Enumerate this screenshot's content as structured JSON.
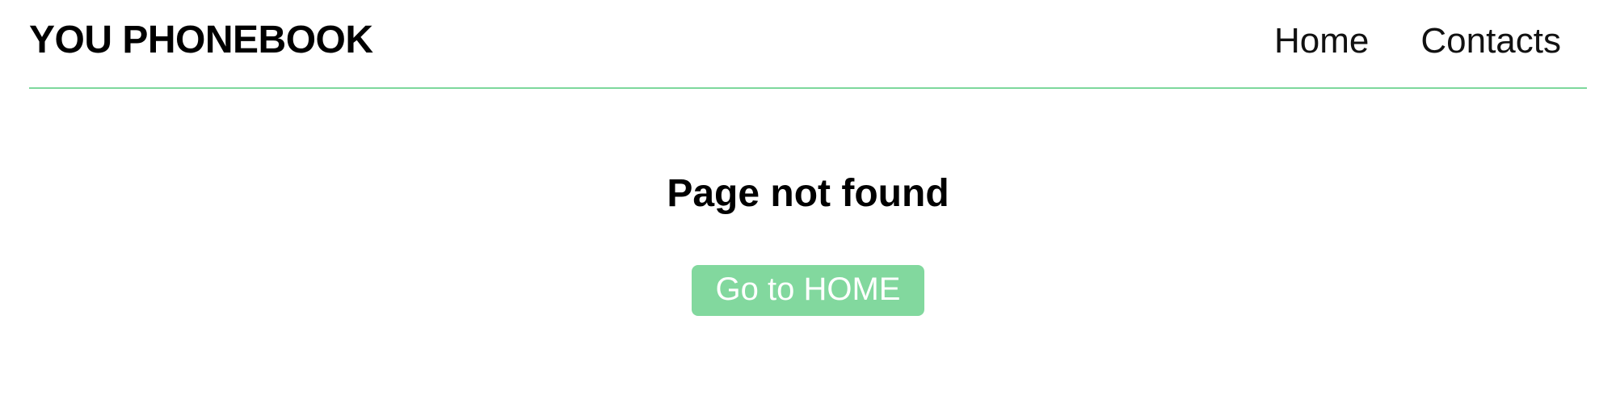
{
  "header": {
    "brand": "YOU PHONEBOOK",
    "nav": {
      "home": "Home",
      "contacts": "Contacts"
    }
  },
  "main": {
    "title": "Page not found",
    "home_button_label": "Go to HOME"
  },
  "colors": {
    "accent": "#82d89e",
    "divider": "#7dd89c"
  }
}
